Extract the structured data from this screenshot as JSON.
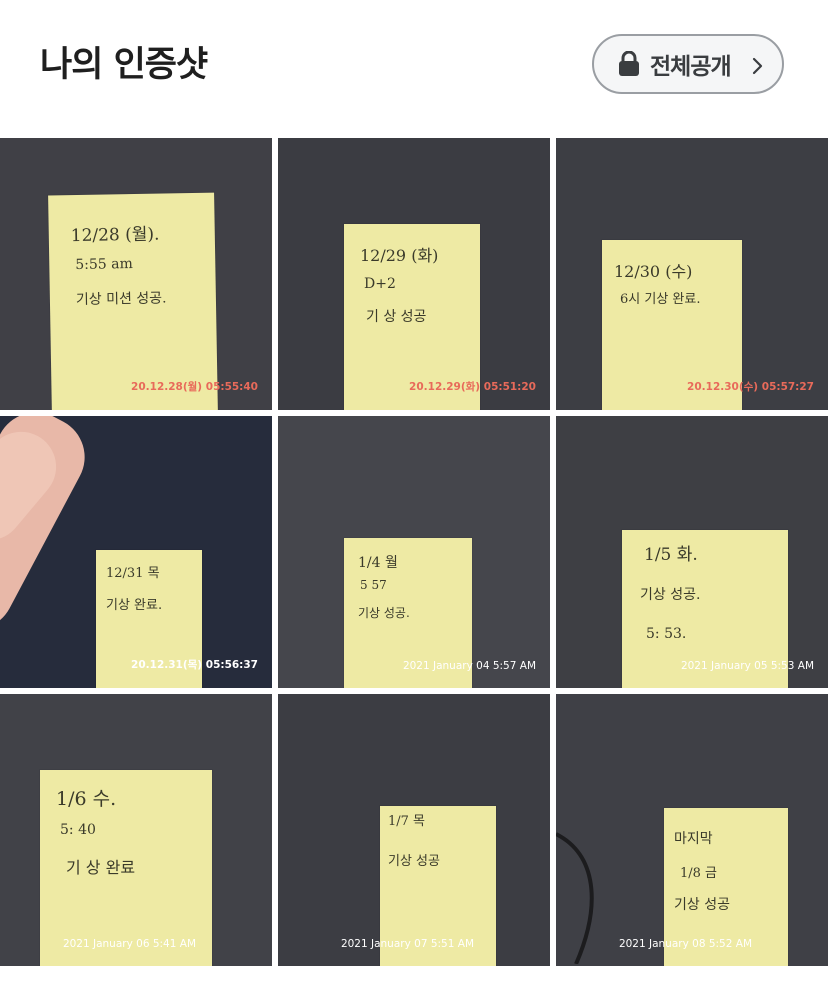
{
  "header": {
    "title": "나의 인증샷",
    "visibility_label": "전체공개",
    "lock_icon": "lock-icon",
    "chevron_icon": "chevron-right-icon"
  },
  "photos": [
    {
      "note_lines": [
        "12/28 (월).",
        "5:55 am",
        "기상 미션 성공."
      ],
      "timestamp": "20.12.28(월) 05:55:40",
      "stamp_color": "#e86a5a"
    },
    {
      "note_lines": [
        "12/29 (화)",
        "D+2",
        "기 상 성공"
      ],
      "timestamp": "20.12.29(화) 05:51:20",
      "stamp_color": "#e86a5a"
    },
    {
      "note_lines": [
        "12/30 (수)",
        "6시 기상 완료."
      ],
      "timestamp": "20.12.30(수) 05:57:27",
      "stamp_color": "#e86a5a"
    },
    {
      "note_lines": [
        "12/31 목",
        "기상 완료."
      ],
      "timestamp": "20.12.31(목) 05:56:37",
      "stamp_color": "#ffffff"
    },
    {
      "note_lines": [
        "1/4 월",
        "5 57",
        "기상 성공."
      ],
      "timestamp": "2021 January 04 5:57 AM",
      "stamp_color": "#ffffff"
    },
    {
      "note_lines": [
        "1/5 화.",
        "기상 성공.",
        "5: 53."
      ],
      "timestamp": "2021 January 05 5:53 AM",
      "stamp_color": "#ffffff"
    },
    {
      "note_lines": [
        "1/6 수.",
        "5: 40",
        "기 상 완료"
      ],
      "timestamp": "2021 January 06 5:41 AM",
      "stamp_color": "#ffffff"
    },
    {
      "note_lines": [
        "1/7 목",
        "기상 성공"
      ],
      "timestamp": "2021 January 07 5:51 AM",
      "stamp_color": "#ffffff"
    },
    {
      "note_lines": [
        "마지막",
        "1/8 금",
        "기상 성공"
      ],
      "timestamp": "2021 January 08 5:52 AM",
      "stamp_color": "#ffffff"
    }
  ]
}
